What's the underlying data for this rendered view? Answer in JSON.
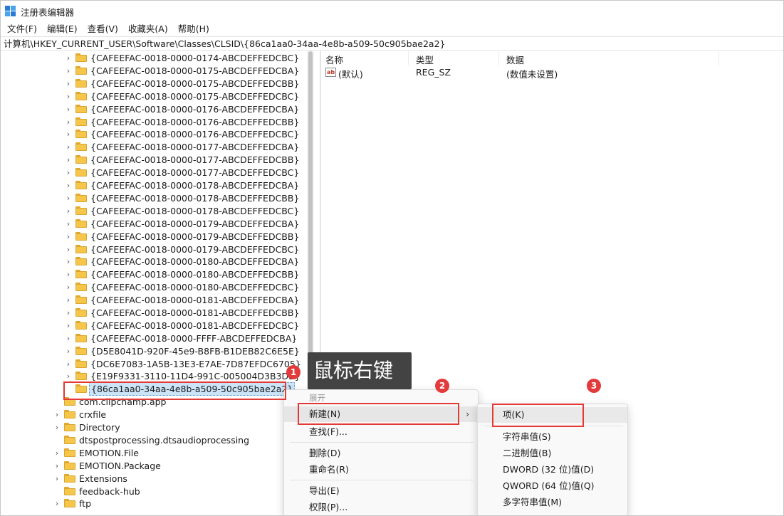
{
  "window": {
    "title": "注册表编辑器"
  },
  "menu": [
    "文件(F)",
    "编辑(E)",
    "查看(V)",
    "收藏夹(A)",
    "帮助(H)"
  ],
  "address": "计算机\\HKEY_CURRENT_USER\\Software\\Classes\\CLSID\\{86ca1aa0-34aa-4e8b-a509-50c905bae2a2}",
  "tree": {
    "clsid_children": [
      "{CAFEEFAC-0018-0000-0174-ABCDEFFEDCBC}",
      "{CAFEEFAC-0018-0000-0175-ABCDEFFEDCBA}",
      "{CAFEEFAC-0018-0000-0175-ABCDEFFEDCBB}",
      "{CAFEEFAC-0018-0000-0175-ABCDEFFEDCBC}",
      "{CAFEEFAC-0018-0000-0176-ABCDEFFEDCBA}",
      "{CAFEEFAC-0018-0000-0176-ABCDEFFEDCBB}",
      "{CAFEEFAC-0018-0000-0176-ABCDEFFEDCBC}",
      "{CAFEEFAC-0018-0000-0177-ABCDEFFEDCBA}",
      "{CAFEEFAC-0018-0000-0177-ABCDEFFEDCBB}",
      "{CAFEEFAC-0018-0000-0177-ABCDEFFEDCBC}",
      "{CAFEEFAC-0018-0000-0178-ABCDEFFEDCBA}",
      "{CAFEEFAC-0018-0000-0178-ABCDEFFEDCBB}",
      "{CAFEEFAC-0018-0000-0178-ABCDEFFEDCBC}",
      "{CAFEEFAC-0018-0000-0179-ABCDEFFEDCBA}",
      "{CAFEEFAC-0018-0000-0179-ABCDEFFEDCBB}",
      "{CAFEEFAC-0018-0000-0179-ABCDEFFEDCBC}",
      "{CAFEEFAC-0018-0000-0180-ABCDEFFEDCBA}",
      "{CAFEEFAC-0018-0000-0180-ABCDEFFEDCBB}",
      "{CAFEEFAC-0018-0000-0180-ABCDEFFEDCBC}",
      "{CAFEEFAC-0018-0000-0181-ABCDEFFEDCBA}",
      "{CAFEEFAC-0018-0000-0181-ABCDEFFEDCBB}",
      "{CAFEEFAC-0018-0000-0181-ABCDEFFEDCBC}",
      "{CAFEEFAC-0018-0000-FFFF-ABCDEFFEDCBA}",
      "{D5E8041D-920F-45e9-B8FB-B1DEB82C6E5E}",
      "{DC6E7083-1A5B-13E3-E7AE-7D87EFDC6705}",
      "{E19F9331-3110-11D4-991C-005004D3B3DB}"
    ],
    "selected": "{86ca1aa0-34aa-4e8b-a509-50c905bae2a2}",
    "classes_children": [
      {
        "label": "com.clipchamp.app",
        "expandable": false
      },
      {
        "label": "crxfile",
        "expandable": true
      },
      {
        "label": "Directory",
        "expandable": true
      },
      {
        "label": "dtspostprocessing.dtsaudioprocessing",
        "expandable": false
      },
      {
        "label": "EMOTION.File",
        "expandable": true
      },
      {
        "label": "EMOTION.Package",
        "expandable": true
      },
      {
        "label": "Extensions",
        "expandable": true
      },
      {
        "label": "feedback-hub",
        "expandable": false
      },
      {
        "label": "ftp",
        "expandable": true
      }
    ]
  },
  "values": {
    "headers": {
      "name": "名称",
      "type": "类型",
      "data": "数据"
    },
    "rows": [
      {
        "icon": "string-value-icon",
        "icon_text": "ab",
        "name": "(默认)",
        "type": "REG_SZ",
        "data": "(数值未设置)"
      }
    ]
  },
  "annotation": {
    "tooltip": "鼠标右键",
    "badges": [
      "1",
      "2",
      "3"
    ]
  },
  "context_menu": {
    "header": "展开",
    "items": [
      {
        "label": "新建(N)",
        "submenu": true
      },
      {
        "label": "查找(F)..."
      },
      {
        "label": "删除(D)"
      },
      {
        "label": "重命名(R)"
      },
      {
        "label": "导出(E)"
      },
      {
        "label": "权限(P)..."
      }
    ]
  },
  "submenu": {
    "items": [
      {
        "label": "项(K)"
      },
      {
        "label": "字符串值(S)"
      },
      {
        "label": "二进制值(B)"
      },
      {
        "label": "DWORD (32 位)值(D)"
      },
      {
        "label": "QWORD (64 位)值(Q)"
      },
      {
        "label": "多字符串值(M)"
      }
    ]
  },
  "colors": {
    "highlight": "#e53935",
    "badge": "#e33b3b",
    "tooltip_bg": "#434343",
    "selection": "#cce4f7",
    "folder": "#f6c64b"
  }
}
